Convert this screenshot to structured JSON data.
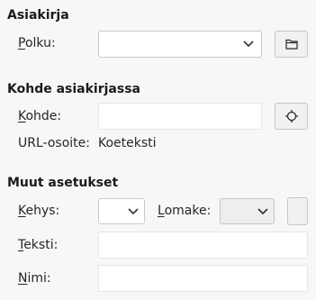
{
  "sections": {
    "document": {
      "title": "Asiakirja",
      "path_label_first": "P",
      "path_label_rest": "olku:",
      "path_value": ""
    },
    "target": {
      "title": "Kohde asiakirjassa",
      "target_label_first": "K",
      "target_label_rest": "ohde:",
      "target_value": "",
      "url_label": "URL-osoite:",
      "url_value": "Koeteksti"
    },
    "other": {
      "title": "Muut asetukset",
      "frame_label_first": "K",
      "frame_label_rest": "ehys:",
      "frame_value": "",
      "form_label_first": "L",
      "form_label_rest": "omake:",
      "form_value": "",
      "text_label_first": "T",
      "text_label_rest": "eksti:",
      "text_value": "",
      "name_label_first": "N",
      "name_label_rest": "imi:",
      "name_value": ""
    }
  },
  "icons": {
    "folder": "folder-icon",
    "target": "target-icon",
    "dropdown": "chevron-down-icon"
  }
}
